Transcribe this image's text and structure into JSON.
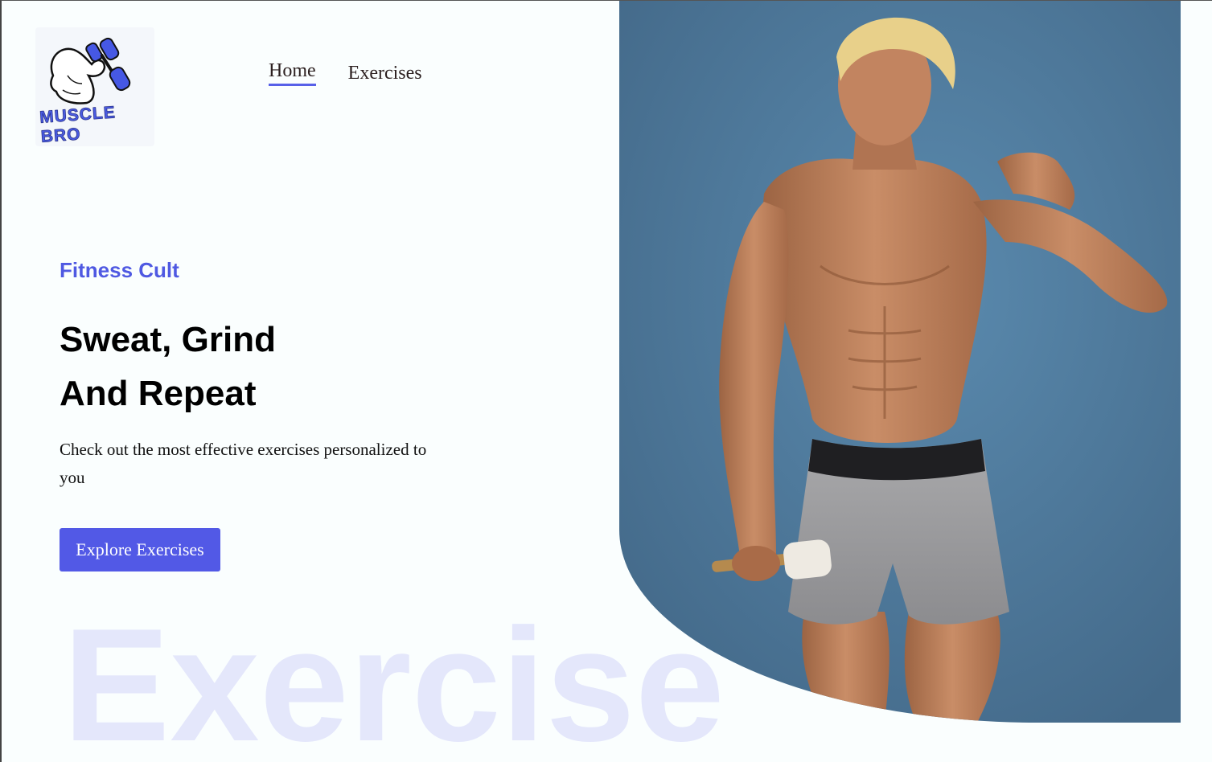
{
  "logo": {
    "text": "MUSCLE BRO",
    "icon": "flexed-arm-dumbbell-icon"
  },
  "nav": {
    "items": [
      {
        "label": "Home",
        "active": true
      },
      {
        "label": "Exercises",
        "active": false
      }
    ]
  },
  "hero": {
    "kicker": "Fitness Cult",
    "headline_line1": "Sweat, Grind",
    "headline_line2": "And Repeat",
    "description": "Check out the most effective exercises personalized to you",
    "cta_label": "Explore Exercises",
    "background_word": "Exercise"
  },
  "colors": {
    "accent": "#5259e6",
    "kicker": "#4f59e2",
    "background_word": "#e4e7fb",
    "image_bg": "#4a7394"
  }
}
